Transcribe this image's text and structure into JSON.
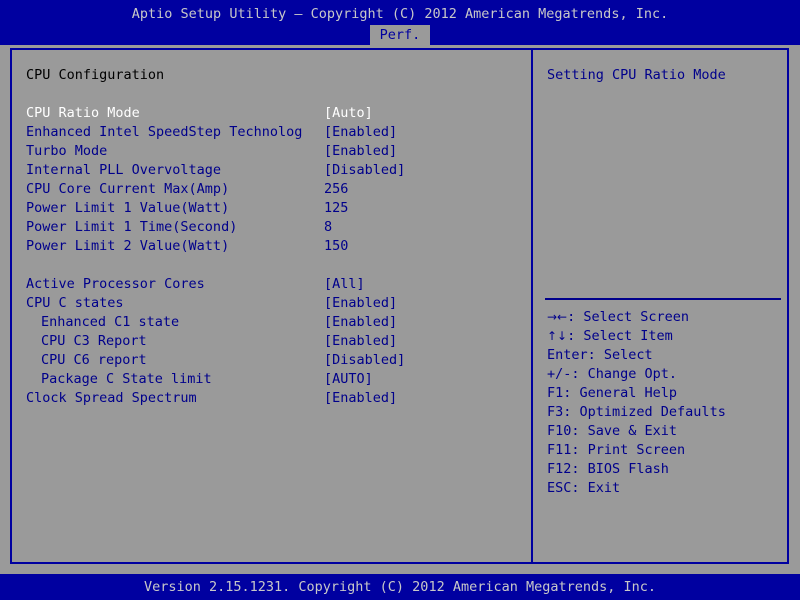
{
  "header": {
    "title": "Aptio Setup Utility – Copyright (C) 2012 American Megatrends, Inc.",
    "tabs": [
      {
        "label": "Perf.",
        "active": true
      }
    ]
  },
  "main": {
    "section_title": "CPU Configuration",
    "options": [
      {
        "label": "CPU Ratio Mode",
        "value": "[Auto]",
        "indent": false,
        "selected": true
      },
      {
        "label": "Enhanced Intel SpeedStep Technolog",
        "value": "[Enabled]",
        "indent": false,
        "selected": false
      },
      {
        "label": "Turbo Mode",
        "value": "[Enabled]",
        "indent": false,
        "selected": false
      },
      {
        "label": "Internal PLL Overvoltage",
        "value": "[Disabled]",
        "indent": false,
        "selected": false
      },
      {
        "label": "CPU Core Current Max(Amp)",
        "value": "256",
        "indent": false,
        "selected": false
      },
      {
        "label": "Power Limit 1 Value(Watt)",
        "value": "125",
        "indent": false,
        "selected": false
      },
      {
        "label": "Power Limit 1 Time(Second)",
        "value": "8",
        "indent": false,
        "selected": false
      },
      {
        "label": "Power Limit 2 Value(Watt)",
        "value": "150",
        "indent": false,
        "selected": false
      },
      {
        "spacer": true
      },
      {
        "label": "Active Processor Cores",
        "value": "[All]",
        "indent": false,
        "selected": false
      },
      {
        "label": "CPU C states",
        "value": "[Enabled]",
        "indent": false,
        "selected": false
      },
      {
        "label": "Enhanced C1 state",
        "value": "[Enabled]",
        "indent": true,
        "selected": false
      },
      {
        "label": "CPU C3 Report",
        "value": "[Enabled]",
        "indent": true,
        "selected": false
      },
      {
        "label": "CPU C6 report",
        "value": "[Disabled]",
        "indent": true,
        "selected": false
      },
      {
        "label": "Package C State limit",
        "value": "[AUTO]",
        "indent": true,
        "selected": false
      },
      {
        "label": "Clock Spread Spectrum",
        "value": "[Enabled]",
        "indent": false,
        "selected": false
      }
    ]
  },
  "help": {
    "description": "Setting CPU Ratio Mode",
    "key_legend": [
      {
        "keys": "→←",
        "glyph": true,
        "text": ": Select Screen"
      },
      {
        "keys": "↑↓",
        "glyph": true,
        "text": ": Select Item"
      },
      {
        "keys": "Enter",
        "glyph": false,
        "text": ": Select"
      },
      {
        "keys": "+/-",
        "glyph": false,
        "text": ": Change Opt."
      },
      {
        "keys": "F1",
        "glyph": false,
        "text": ": General Help"
      },
      {
        "keys": "F3",
        "glyph": false,
        "text": ": Optimized Defaults"
      },
      {
        "keys": "F10",
        "glyph": false,
        "text": ": Save & Exit"
      },
      {
        "keys": "F11",
        "glyph": false,
        "text": ": Print Screen"
      },
      {
        "keys": "F12",
        "glyph": false,
        "text": ": BIOS Flash"
      },
      {
        "keys": "ESC",
        "glyph": false,
        "text": ": Exit"
      }
    ]
  },
  "footer": {
    "version": "Version 2.15.1231. Copyright (C) 2012 American Megatrends, Inc."
  },
  "colors": {
    "chrome_blue": "#0000a0",
    "text_blue": "#00008b",
    "background_gray": "#9a9a9a",
    "selected_text": "#ffffff",
    "chrome_text": "#c8c8c8",
    "section_title": "#000000"
  }
}
